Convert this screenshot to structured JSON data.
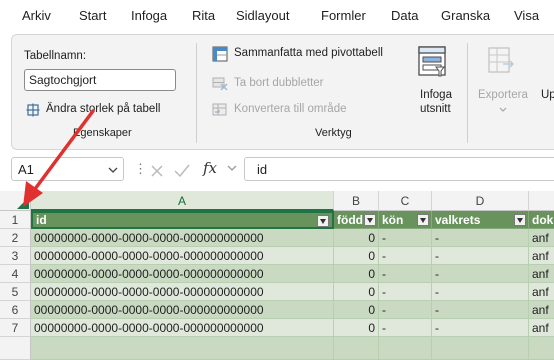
{
  "menu": {
    "tabs": [
      "Arkiv",
      "Start",
      "Infoga",
      "Rita",
      "Sidlayout",
      "Formler",
      "Data",
      "Granska",
      "Visa"
    ]
  },
  "ribbon": {
    "properties": {
      "table_name_label": "Tabellnamn:",
      "table_name_value": "Sagtochgjort",
      "resize_label": "Ändra storlek på tabell",
      "group_title": "Egenskaper"
    },
    "tools": {
      "pivot_label": "Sammanfatta med pivottabell",
      "remove_dupes_label": "Ta bort dubbletter",
      "convert_label": "Konvertera till område",
      "slicer_label_line1": "Infoga",
      "slicer_label_line2": "utsnitt",
      "group_title": "Verktyg"
    },
    "external": {
      "export_label": "Exportera",
      "update_label_partial": "Up"
    }
  },
  "formula_bar": {
    "name_box": "A1",
    "fx_symbol": "fx",
    "content": "id"
  },
  "grid": {
    "columns": [
      "A",
      "B",
      "C",
      "D"
    ],
    "header_row": {
      "row_number": "1",
      "cells": [
        "id",
        "född",
        "kön",
        "valkrets",
        "dok"
      ]
    },
    "rows": [
      {
        "row_number": "2",
        "id": "00000000-0000-0000-0000-000000000000",
        "fodd": "0",
        "kon": "-",
        "valkrets": "-",
        "dok": "anf"
      },
      {
        "row_number": "3",
        "id": "00000000-0000-0000-0000-000000000000",
        "fodd": "0",
        "kon": "-",
        "valkrets": "-",
        "dok": "anf"
      },
      {
        "row_number": "4",
        "id": "00000000-0000-0000-0000-000000000000",
        "fodd": "0",
        "kon": "-",
        "valkrets": "-",
        "dok": "anf"
      },
      {
        "row_number": "5",
        "id": "00000000-0000-0000-0000-000000000000",
        "fodd": "0",
        "kon": "-",
        "valkrets": "-",
        "dok": "anf"
      },
      {
        "row_number": "6",
        "id": "00000000-0000-0000-0000-000000000000",
        "fodd": "0",
        "kon": "-",
        "valkrets": "-",
        "dok": "anf"
      },
      {
        "row_number": "7",
        "id": "00000000-0000-0000-0000-000000000000",
        "fodd": "0",
        "kon": "-",
        "valkrets": "-",
        "dok": "anf"
      }
    ]
  },
  "colors": {
    "header_green": "#68935c",
    "band_dark": "#c9d9c2",
    "band_light": "#dfe8da",
    "annotation_arrow": "#e03030",
    "selected_col": "#217346"
  },
  "icons": {
    "pivot": "pivot-table-icon",
    "remove_duplicates": "remove-duplicates-icon",
    "convert": "convert-to-range-icon",
    "slicer": "insert-slicer-icon",
    "export": "export-icon",
    "resize": "resize-table-icon",
    "select_all": "select-all-triangle-icon",
    "annotation": "annotation-arrow"
  }
}
